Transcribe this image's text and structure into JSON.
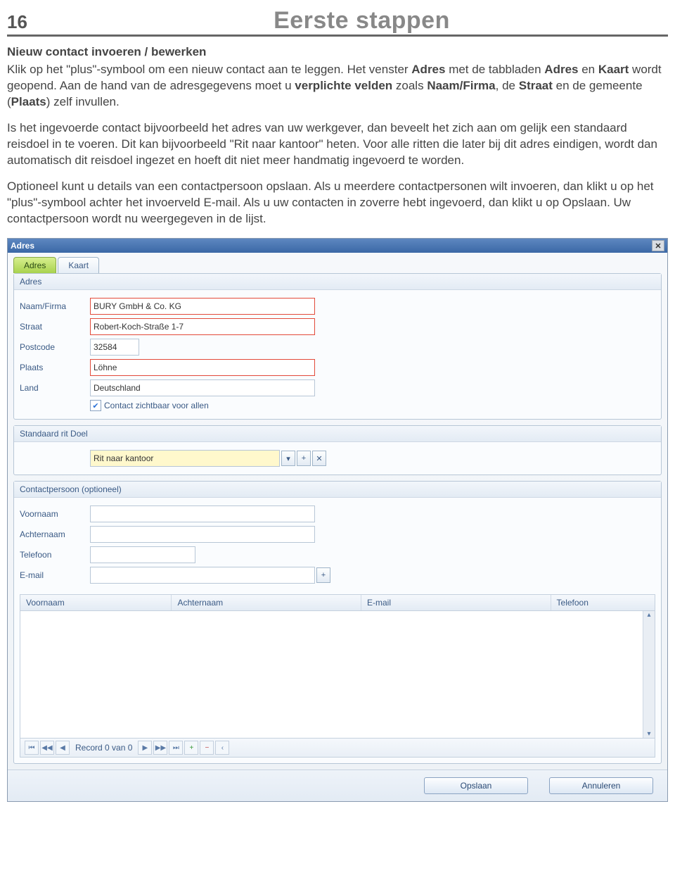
{
  "page": {
    "number": "16",
    "title": "Eerste stappen"
  },
  "body": {
    "heading": "Nieuw contact invoeren / bewerken",
    "p1a": "Klik op het \"plus\"-symbool om een nieuw contact aan te leggen. Het venster ",
    "p1b": "Adres",
    "p1c": " met de tabbladen ",
    "p1d": "Adres",
    "p1e": " en ",
    "p1f": "Kaart",
    "p1g": " wordt geopend. Aan de hand van de adresgegevens moet u ",
    "p1h": "verplichte velden",
    "p1i": " zoals ",
    "p1j": "Naam/Firma",
    "p1k": ", de ",
    "p1l": "Straat",
    "p1m": " en de gemeente (",
    "p1n": "Plaats",
    "p1o": ") zelf invullen.",
    "p2": "Is het ingevoerde contact bijvoorbeeld het adres van uw werkgever, dan beveelt het zich aan om gelijk een standaard reisdoel in te voeren. Dit kan bijvoorbeeld \"Rit naar kantoor\" heten. Voor alle ritten die later bij dit adres eindigen, wordt dan automatisch dit reisdoel ingezet en hoeft dit niet meer handmatig ingevoerd te worden.",
    "p3": "Optioneel kunt u details van een contactpersoon opslaan. Als u meerdere contactpersonen wilt invoeren, dan klikt u op het \"plus\"-symbool achter het invoerveld E-mail. Als u uw contacten in zoverre hebt ingevoerd, dan klikt u op Opslaan. Uw contactpersoon wordt nu weergegeven in de lijst."
  },
  "win": {
    "title": "Adres",
    "tabs": [
      "Adres",
      "Kaart"
    ],
    "panels": {
      "adres": {
        "header": "Adres",
        "labels": {
          "naam": "Naam/Firma",
          "straat": "Straat",
          "postcode": "Postcode",
          "plaats": "Plaats",
          "land": "Land"
        },
        "values": {
          "naam": "BURY GmbH & Co. KG",
          "straat": "Robert-Koch-Straße 1-7",
          "postcode": "32584",
          "plaats": "Löhne",
          "land": "Deutschland"
        },
        "checkbox": "Contact zichtbaar voor allen"
      },
      "doel": {
        "header": "Standaard rit Doel",
        "value": "Rit naar kantoor"
      },
      "contact": {
        "header": "Contactpersoon (optioneel)",
        "labels": {
          "voornaam": "Voornaam",
          "achternaam": "Achternaam",
          "telefoon": "Telefoon",
          "email": "E-mail"
        },
        "cols": {
          "c1": "Voornaam",
          "c2": "Achternaam",
          "c3": "E-mail",
          "c4": "Telefoon"
        },
        "pager": "Record 0 van 0"
      }
    },
    "actions": {
      "save": "Opslaan",
      "cancel": "Annuleren"
    }
  }
}
